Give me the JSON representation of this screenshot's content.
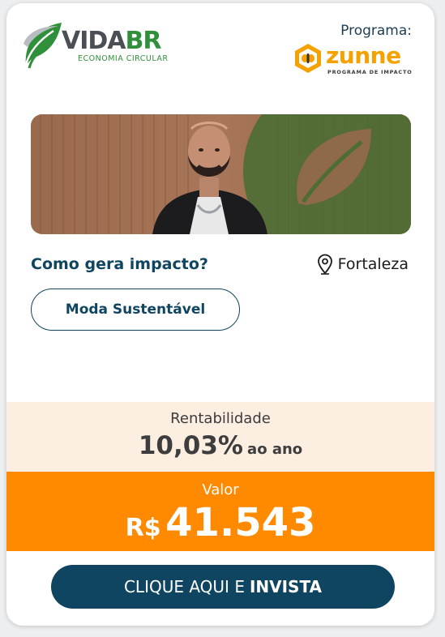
{
  "brand": {
    "name_main": "VIDA",
    "name_accent": "BR",
    "subtitle": "ECONOMIA CIRCULAR",
    "colors": {
      "primary": "#4a4f55",
      "accent": "#2f8f3a"
    }
  },
  "program": {
    "label": "Programa:",
    "logo_name": "zunne",
    "logo_subtitle": "PROGRAMA DE IMPACTO",
    "color": "#f5a100"
  },
  "photo": {
    "alt_icon": "founder-photo"
  },
  "impact": {
    "title": "Como gera impacto?",
    "location_icon": "map-pin-icon",
    "location": "Fortaleza",
    "category": "Moda Sustentável"
  },
  "returns": {
    "label": "Rentabilidade",
    "value": "10,03%",
    "unit": "ao ano",
    "bg_color": "#fdeee2"
  },
  "amount": {
    "label": "Valor",
    "currency": "R$",
    "value": "41.543",
    "bg_color": "#ff8a00"
  },
  "cta": {
    "text": "CLIQUE AQUI E",
    "text_bold": "INVISTA",
    "color": "#0f4560"
  }
}
